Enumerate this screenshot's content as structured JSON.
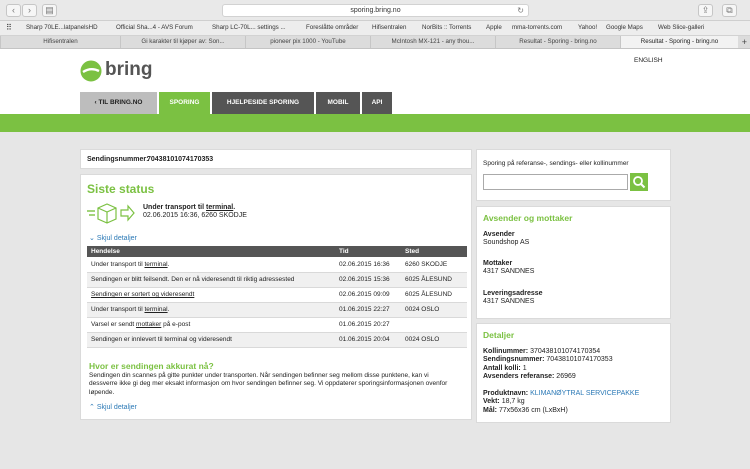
{
  "browser": {
    "url": "sporing.bring.no"
  },
  "bookmarks": [
    "Sharp 70LE...latpanelsHD",
    "Official Sha...4 - AVS Forum",
    "Sharp LC-70L... settings ...",
    "Foreslåtte områder",
    "Hifisentralen",
    "NorBits :: Torrents",
    "Apple",
    "mma-torrents.com",
    "Yahoo!",
    "Google Maps",
    "Web Slice-galleri"
  ],
  "tabs": [
    "Hifisentralen",
    "Gi karakter til kjøper av: Son...",
    "pioneer pix 1000 - YouTube",
    "McIntosh MX-121 - any thou...",
    "Resultat - Sporing - bring.no",
    "Resultat - Sporing - bring.no"
  ],
  "logo_text": "bring",
  "lang": "ENGLISH",
  "nav": {
    "back": "TIL BRING.NO",
    "items": [
      "SPORING",
      "HJELPESIDE SPORING",
      "MOBIL",
      "API"
    ]
  },
  "shipment": {
    "label": "Sendingsnummer:",
    "number": "70438101074170353"
  },
  "status": {
    "title": "Siste status",
    "current": "Under transport til terminal.",
    "current_prefix": "Under transport til ",
    "current_link": "terminal",
    "current_suffix": ".",
    "date_place": "02.06.2015 16:36, 6260 SKODJE",
    "hide": "Skjul detaljer",
    "headers": [
      "Hendelse",
      "Tid",
      "Sted"
    ],
    "rows": [
      {
        "event": "Under transport til terminal.",
        "time": "02.06.2015 16:36",
        "place": "6260 SKODJE"
      },
      {
        "event": "Sendingen er blitt feilsendt. Den er nå videresendt til riktig adressested",
        "time": "02.06.2015 15:36",
        "place": "6025 ÅLESUND"
      },
      {
        "event": "Sendingen er sortert og videresendt",
        "time": "02.06.2015 09:09",
        "place": "6025 ÅLESUND"
      },
      {
        "event": "Under transport til terminal.",
        "time": "01.06.2015 22:27",
        "place": "0024 OSLO"
      },
      {
        "event": "Varsel er sendt mottaker på e-post",
        "time": "01.06.2015 20:27",
        "place": ""
      },
      {
        "event": "Sendingen er innlevert til terminal og videresendt",
        "time": "01.06.2015 20:04",
        "place": "0024 OSLO"
      }
    ],
    "where_title": "Hvor er sendingen akkurat nå?",
    "where_text": "Sendingen din scannes på gitte punkter under transporten. Når sendingen befinner seg mellom disse punktene, kan vi dessverre ikke gi deg mer eksakt informasjon om hvor sendingen befinner seg. Vi oppdaterer sporingsinformasjonen ovenfor løpende.",
    "hide2": "Skjul detaljer"
  },
  "search": {
    "label": "Sporing på referanse-, sendings- eller kollinummer",
    "placeholder": ""
  },
  "parties": {
    "title": "Avsender og mottaker",
    "sender_label": "Avsender",
    "sender": "Soundshop AS",
    "recipient_label": "Mottaker",
    "recipient": "4317 SANDNES",
    "delivery_label": "Leveringsadresse",
    "delivery": "4317 SANDNES"
  },
  "details": {
    "title": "Detaljer",
    "rows": [
      {
        "k": "Kollinummer:",
        "v": "370438101074170354"
      },
      {
        "k": "Sendingsnummer:",
        "v": "70438101074170353"
      },
      {
        "k": "Antall kolli:",
        "v": "1"
      },
      {
        "k": "Avsenders referanse:",
        "v": "26969"
      }
    ],
    "product_label": "Produktnavn:",
    "product": "KLIMANØYTRAL SERVICEPAKKE",
    "weight_label": "Vekt:",
    "weight": "18,7 kg",
    "size_label": "Mål:",
    "size": "77x56x36 cm (LxBxH)"
  },
  "colors": {
    "brand_green": "#7bc142",
    "nav_dark": "#555555",
    "link_blue": "#2b79b6"
  }
}
